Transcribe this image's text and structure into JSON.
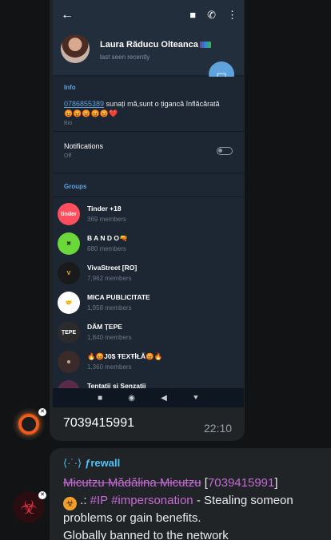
{
  "phone": {
    "profile": {
      "name": "Laura Răducu Olteanca",
      "status": "last seen recently"
    },
    "info": {
      "section_title": "Info",
      "bio_phone": "0786855389",
      "bio_text": " sunați mă,sunt o țigancă înflăcărată 😡😡😡😡😡❤️",
      "bio_label": "Bio",
      "notifications_label": "Notifications",
      "notifications_value": "Off"
    },
    "groups": {
      "tab_label": "Groups",
      "items": [
        {
          "name": "Tinder +18",
          "members": "369 members",
          "avatar_text": "tinder",
          "avatar_bg": "#ff4f5e",
          "avatar_fg": "#ffffff"
        },
        {
          "name": "B A N D O🔫",
          "members": "680 members",
          "avatar_text": "✖",
          "avatar_bg": "#6bd83a",
          "avatar_fg": "#2a3a18"
        },
        {
          "name": "VivaStreet [RO]",
          "members": "7,962 members",
          "avatar_text": "V",
          "avatar_bg": "#1a1a1a",
          "avatar_fg": "#f2c230"
        },
        {
          "name": "MICA PUBLICITATE",
          "members": "1,958 members",
          "avatar_text": "🤝",
          "avatar_bg": "#ffffff",
          "avatar_fg": "#000000"
        },
        {
          "name": "DĂM ȚEPE",
          "members": "1,840 members",
          "avatar_text": "ȚEPE",
          "avatar_bg": "#2b2b2b",
          "avatar_fg": "#ffffff"
        },
        {
          "name": "🔥😡J0$ ŦEXŦİŁĂ😡🔥",
          "members": "1,360 members",
          "avatar_text": "☻",
          "avatar_bg": "#3a2a2a",
          "avatar_fg": "#d0b090"
        },
        {
          "name": "Tentatii si Senzatii",
          "members": "",
          "avatar_text": "",
          "avatar_bg": "#5a2a4a",
          "avatar_fg": "#ffffff"
        }
      ]
    },
    "navbar": {
      "square": "■",
      "circle": "◉",
      "back": "◀",
      "down": "⯆"
    }
  },
  "message_1": {
    "caption": "7039415991",
    "time": "22:10"
  },
  "message_2": {
    "sender_dots": "⟨·˙·⟩",
    "sender": "ƒrewall",
    "struck_name": "Micutzu Mădălina Micutzu",
    "bracket_open": " [",
    "user_id": "7039415991",
    "bracket_close": "]",
    "hazard": "☣",
    "separator": " .: ",
    "tag_1": "#IP",
    "tag_2": " #impersonation",
    "line_2_rest": " - Stealing someon",
    "line_3": "problems or gain benefits.",
    "line_4": "Globally banned to the network"
  },
  "colors": {
    "app_bg": "#111315",
    "bubble_bg": "#212427",
    "telegram_accent": "#5fa3de",
    "link_purple": "#c66ad5",
    "sender_blue": "#4fc3f7"
  }
}
